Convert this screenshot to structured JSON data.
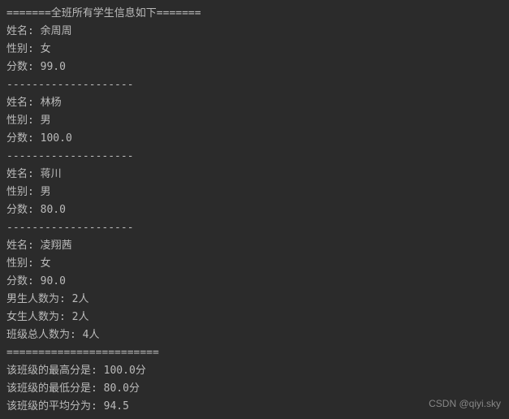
{
  "header": "=======全班所有学生信息如下=======",
  "labels": {
    "name": "姓名: ",
    "gender": "性别: ",
    "score": "分数: "
  },
  "divider_small": "--------------------",
  "divider_big": "========================",
  "students": [
    {
      "name": "余周周",
      "gender": "女",
      "score": "99.0"
    },
    {
      "name": "林杨",
      "gender": "男",
      "score": "100.0"
    },
    {
      "name": "蒋川",
      "gender": "男",
      "score": "80.0"
    },
    {
      "name": "凌翔茜",
      "gender": "女",
      "score": "90.0"
    }
  ],
  "stats": {
    "male_count_label": "男生人数为: ",
    "male_count_value": "2人",
    "female_count_label": "女生人数为: ",
    "female_count_value": "2人",
    "total_count_label": "班级总人数为: ",
    "total_count_value": "4人",
    "max_label": "该班级的最高分是: ",
    "max_value": "100.0分",
    "min_label": "该班级的最低分是: ",
    "min_value": "80.0分",
    "avg_label": "该班级的平均分为: ",
    "avg_value": "94.5"
  },
  "watermark": "CSDN @qiyi.sky"
}
